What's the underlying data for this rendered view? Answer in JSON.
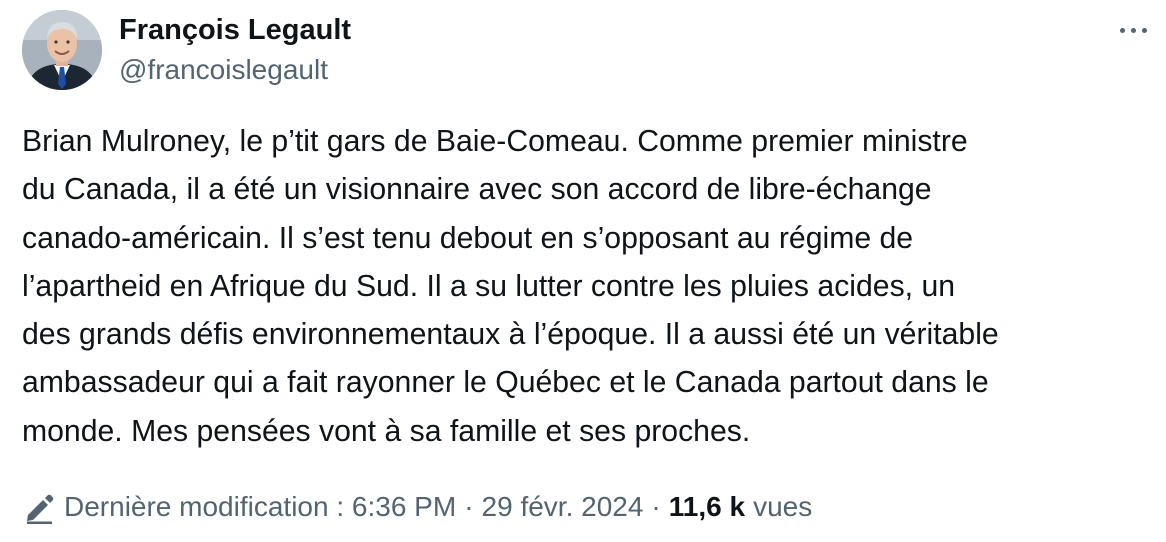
{
  "author": {
    "name": "François Legault",
    "handle": "@francoislegault",
    "avatar_icon": "profile-photo"
  },
  "more_icon": "more-horizontal-icon",
  "tweet": {
    "lines": [
      "Brian Mulroney, le p’tit gars de Baie-Comeau. Comme premier ministre",
      "du Canada, il a été un visionnaire avec son accord de libre-échange",
      "canado-américain. Il s’est tenu debout en s’opposant au régime de",
      "l’apartheid en Afrique du Sud. Il a su lutter contre les pluies acides, un",
      "des grands défis environnementaux à l’époque. Il a aussi été un véritable",
      "ambassadeur qui a fait rayonner le Québec et le Canada partout dans le",
      "monde. Mes pensées vont à sa famille et ses proches."
    ]
  },
  "meta": {
    "edit_icon": "pencil-edit-icon",
    "edited_label": "Dernière modification : 6:36 PM",
    "separator": "·",
    "date": "29 févr. 2024",
    "views_count": "11,6 k",
    "views_label": "vues"
  },
  "colors": {
    "text_primary": "#0f1419",
    "text_secondary": "#536471",
    "background": "#ffffff"
  }
}
